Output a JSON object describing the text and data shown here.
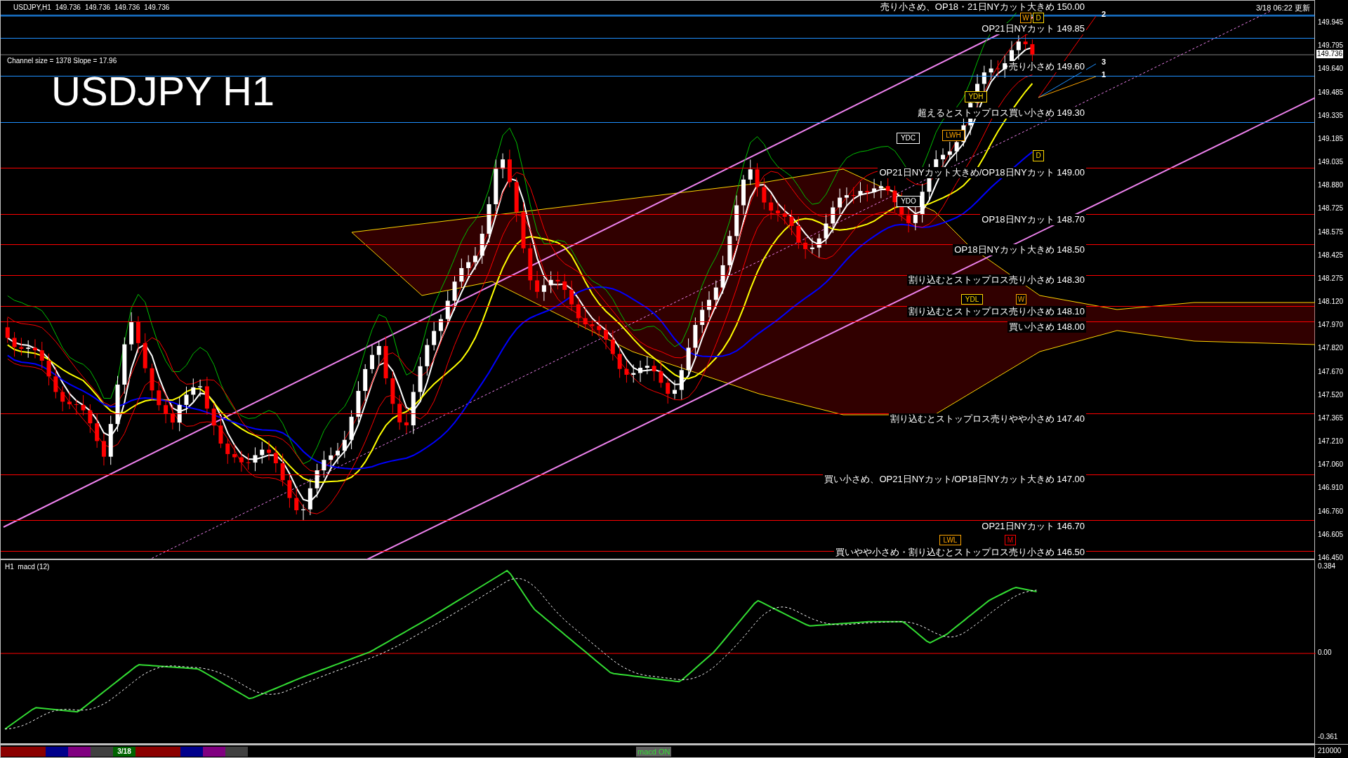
{
  "header": {
    "symbol": "USDJPY,H1",
    "quotes": [
      "149.736",
      "149.736",
      "149.736",
      "149.736"
    ]
  },
  "channel_info": "Channel size = 1378 Slope = 17.96",
  "chart_title": "USDJPY H1",
  "updated": "3/18 06:22 更新",
  "levels": [
    {
      "label": "売り小さめ、OP18・21日NYカット大きめ 150.00",
      "color": "#1e90ff"
    },
    {
      "label": "OP21日NYカット 149.85",
      "color": "#1e90ff"
    },
    {
      "label": "売り小さめ 149.60",
      "color": "#1e90ff"
    },
    {
      "label": "超えるとストップロス買い小さめ 149.30",
      "color": "#1e90ff"
    },
    {
      "label": "OP21日NYカット大きめ/OP18日NYカット 149.00",
      "color": "#ff0000"
    },
    {
      "label": "OP18日NYカット 148.70",
      "color": "#ff0000"
    },
    {
      "label": "OP18日NYカット大きめ 148.50",
      "color": "#ff0000"
    },
    {
      "label": "割り込むとストップロス売り小さめ 148.30",
      "color": "#ff0000"
    },
    {
      "label": "割り込むとストップロス売り小さめ 148.10",
      "color": "#ff0000"
    },
    {
      "label": "買い小さめ 148.00",
      "color": "#ff0000"
    },
    {
      "label": "割り込むとストップロス売りやや小さめ 147.40",
      "color": "#ff0000"
    },
    {
      "label": "買い小さめ、OP21日NYカット/OP18日NYカット大きめ 147.00",
      "color": "#ff0000"
    },
    {
      "label": "OP21日NYカット 146.70",
      "color": "#ff0000"
    },
    {
      "label": "買いやや小さめ・割り込むとストップロス売り小さめ 146.50",
      "color": "#ff0000"
    }
  ],
  "markers": [
    {
      "label": "YDC",
      "color": "#ffffff"
    },
    {
      "label": "YDO",
      "color": "#ffffff"
    },
    {
      "label": "LWH",
      "color": "#ffa500"
    },
    {
      "label": "YDH",
      "color": "#ffd700"
    },
    {
      "label": "W",
      "color": "#ffa500"
    },
    {
      "label": "D",
      "color": "#ffd700"
    },
    {
      "label": "D",
      "color": "#ffd700"
    },
    {
      "label": "YDL",
      "color": "#ffd700"
    },
    {
      "label": "W",
      "color": "#ffa500"
    },
    {
      "label": "LWL",
      "color": "#ffa500"
    },
    {
      "label": "M",
      "color": "#ff0000"
    }
  ],
  "line_numbers": [
    "2",
    "3",
    "1"
  ],
  "price_axis": [
    "149.945",
    "149.795",
    "149.640",
    "149.485",
    "149.335",
    "149.185",
    "149.035",
    "148.880",
    "148.725",
    "148.575",
    "148.425",
    "148.275",
    "148.120",
    "147.970",
    "147.820",
    "147.670",
    "147.520",
    "147.365",
    "147.210",
    "147.060",
    "146.910",
    "146.760",
    "146.605",
    "146.450"
  ],
  "current_price": "149.736",
  "macd": {
    "title": "H1  macd (12)",
    "axis": [
      "0.384",
      "0.00",
      "-0.361"
    ]
  },
  "bottom_bar": {
    "date": "3/18",
    "status": "macd ON",
    "volume_scale": "210000"
  }
}
